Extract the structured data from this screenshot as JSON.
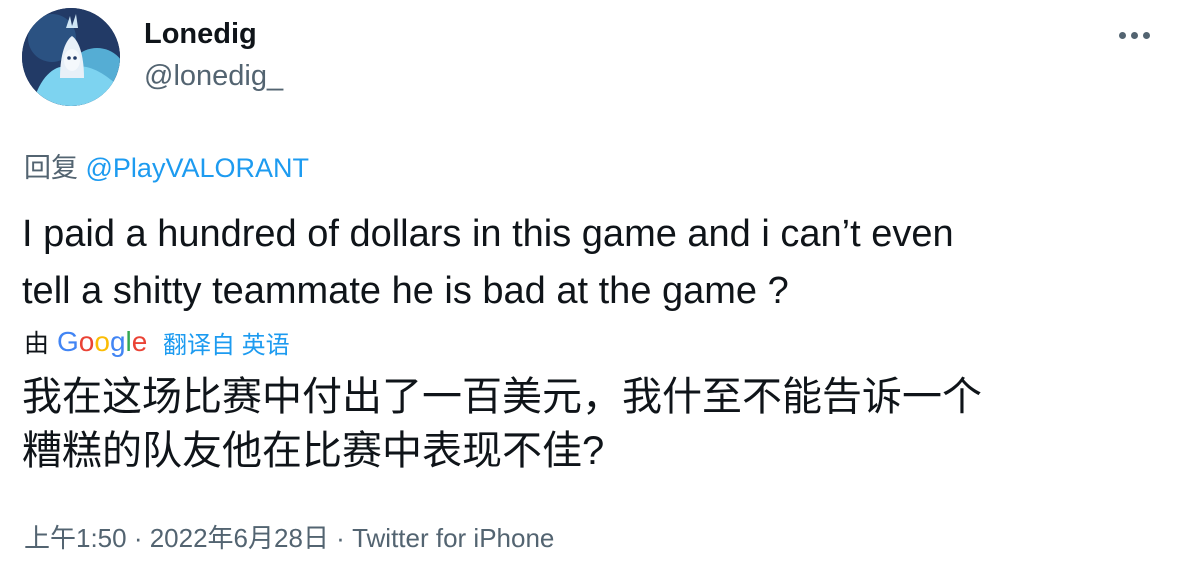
{
  "user": {
    "display_name": "Lonedig",
    "handle": "@lonedig_",
    "avatar_icon": "avatar-illustration-icon"
  },
  "menu": {
    "icon": "more-horizontal-icon"
  },
  "reply": {
    "prefix": "回复 ",
    "mention": "@PlayVALORANT"
  },
  "tweet": {
    "lines": [
      "I paid a hundred of dollars in this game and i can’t even",
      "tell a shitty teammate he is bad at the game ?"
    ]
  },
  "translation": {
    "by": "由",
    "provider": "Google",
    "label": "翻译自 英语",
    "lines": [
      "我在这场比赛中付出了一百美元，我什至不能告诉一个",
      "糟糕的队友他在比赛中表现不佳?"
    ]
  },
  "meta": {
    "time": "上午1:50",
    "date": "2022年6月28日",
    "source": "Twitter for iPhone",
    "separator": " · "
  },
  "colors": {
    "link": "#1d9bf0",
    "secondary": "#536471",
    "text": "#0f1419"
  }
}
